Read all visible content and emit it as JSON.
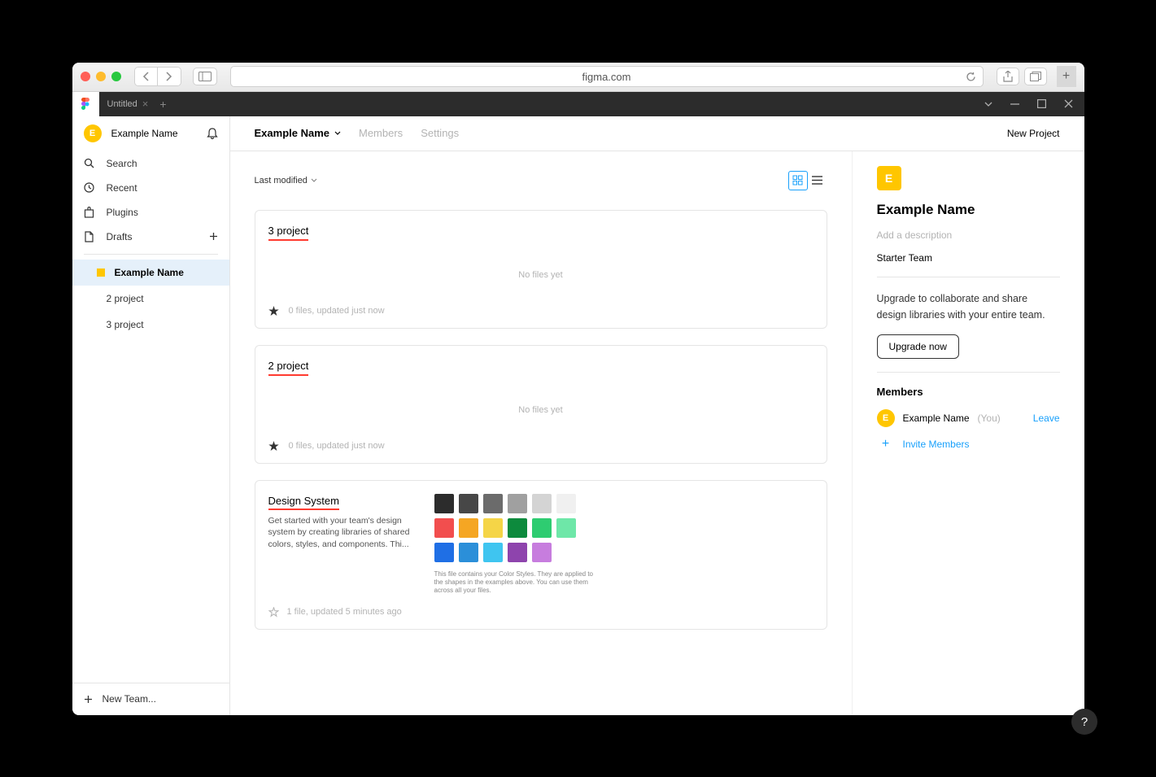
{
  "browser": {
    "url": "figma.com"
  },
  "figma_tabs": {
    "tab_label": "Untitled"
  },
  "sidebar": {
    "user_name": "Example Name",
    "user_initial": "E",
    "items": {
      "search": "Search",
      "recent": "Recent",
      "plugins": "Plugins",
      "drafts": "Drafts"
    },
    "team_name": "Example Name",
    "projects": [
      "2 project",
      "3 project"
    ],
    "new_team": "New Team..."
  },
  "header": {
    "team_name": "Example Name",
    "tab_members": "Members",
    "tab_settings": "Settings",
    "new_project": "New Project"
  },
  "content": {
    "sort_label": "Last modified",
    "projects": [
      {
        "title": "3 project",
        "empty": "No files yet",
        "status": "0 files, updated just now",
        "starred": true
      },
      {
        "title": "2 project",
        "empty": "No files yet",
        "status": "0 files, updated just now",
        "starred": true
      }
    ],
    "design_system": {
      "title": "Design System",
      "description": "Get started with your team's design system by creating libraries of shared colors, styles, and components. Thi...",
      "note": "This file contains your Color Styles. They are applied to the shapes in the examples above. You can use them across all your files.",
      "status": "1 file, updated 5 minutes ago",
      "swatches_row1": [
        "#2c2c2c",
        "#474747",
        "#6b6b6b",
        "#a0a0a0",
        "#d4d4d4",
        "#f0f0f0"
      ],
      "swatches_row2": [
        "#f24e4e",
        "#f5a623",
        "#f5d547",
        "#0d8a3d",
        "#2ecc71",
        "#6ee7a8"
      ],
      "swatches_row3": [
        "#1f6fe5",
        "#2b8fd9",
        "#3fc5f0",
        "#8e44ad",
        "#c77dde"
      ]
    }
  },
  "right": {
    "initial": "E",
    "title": "Example Name",
    "desc_placeholder": "Add a description",
    "team_type": "Starter Team",
    "upgrade_text": "Upgrade to collaborate and share design libraries with your entire team.",
    "upgrade_btn": "Upgrade now",
    "members_heading": "Members",
    "member_name": "Example Name",
    "you_label": "(You)",
    "leave": "Leave",
    "invite": "Invite Members"
  },
  "help": "?"
}
